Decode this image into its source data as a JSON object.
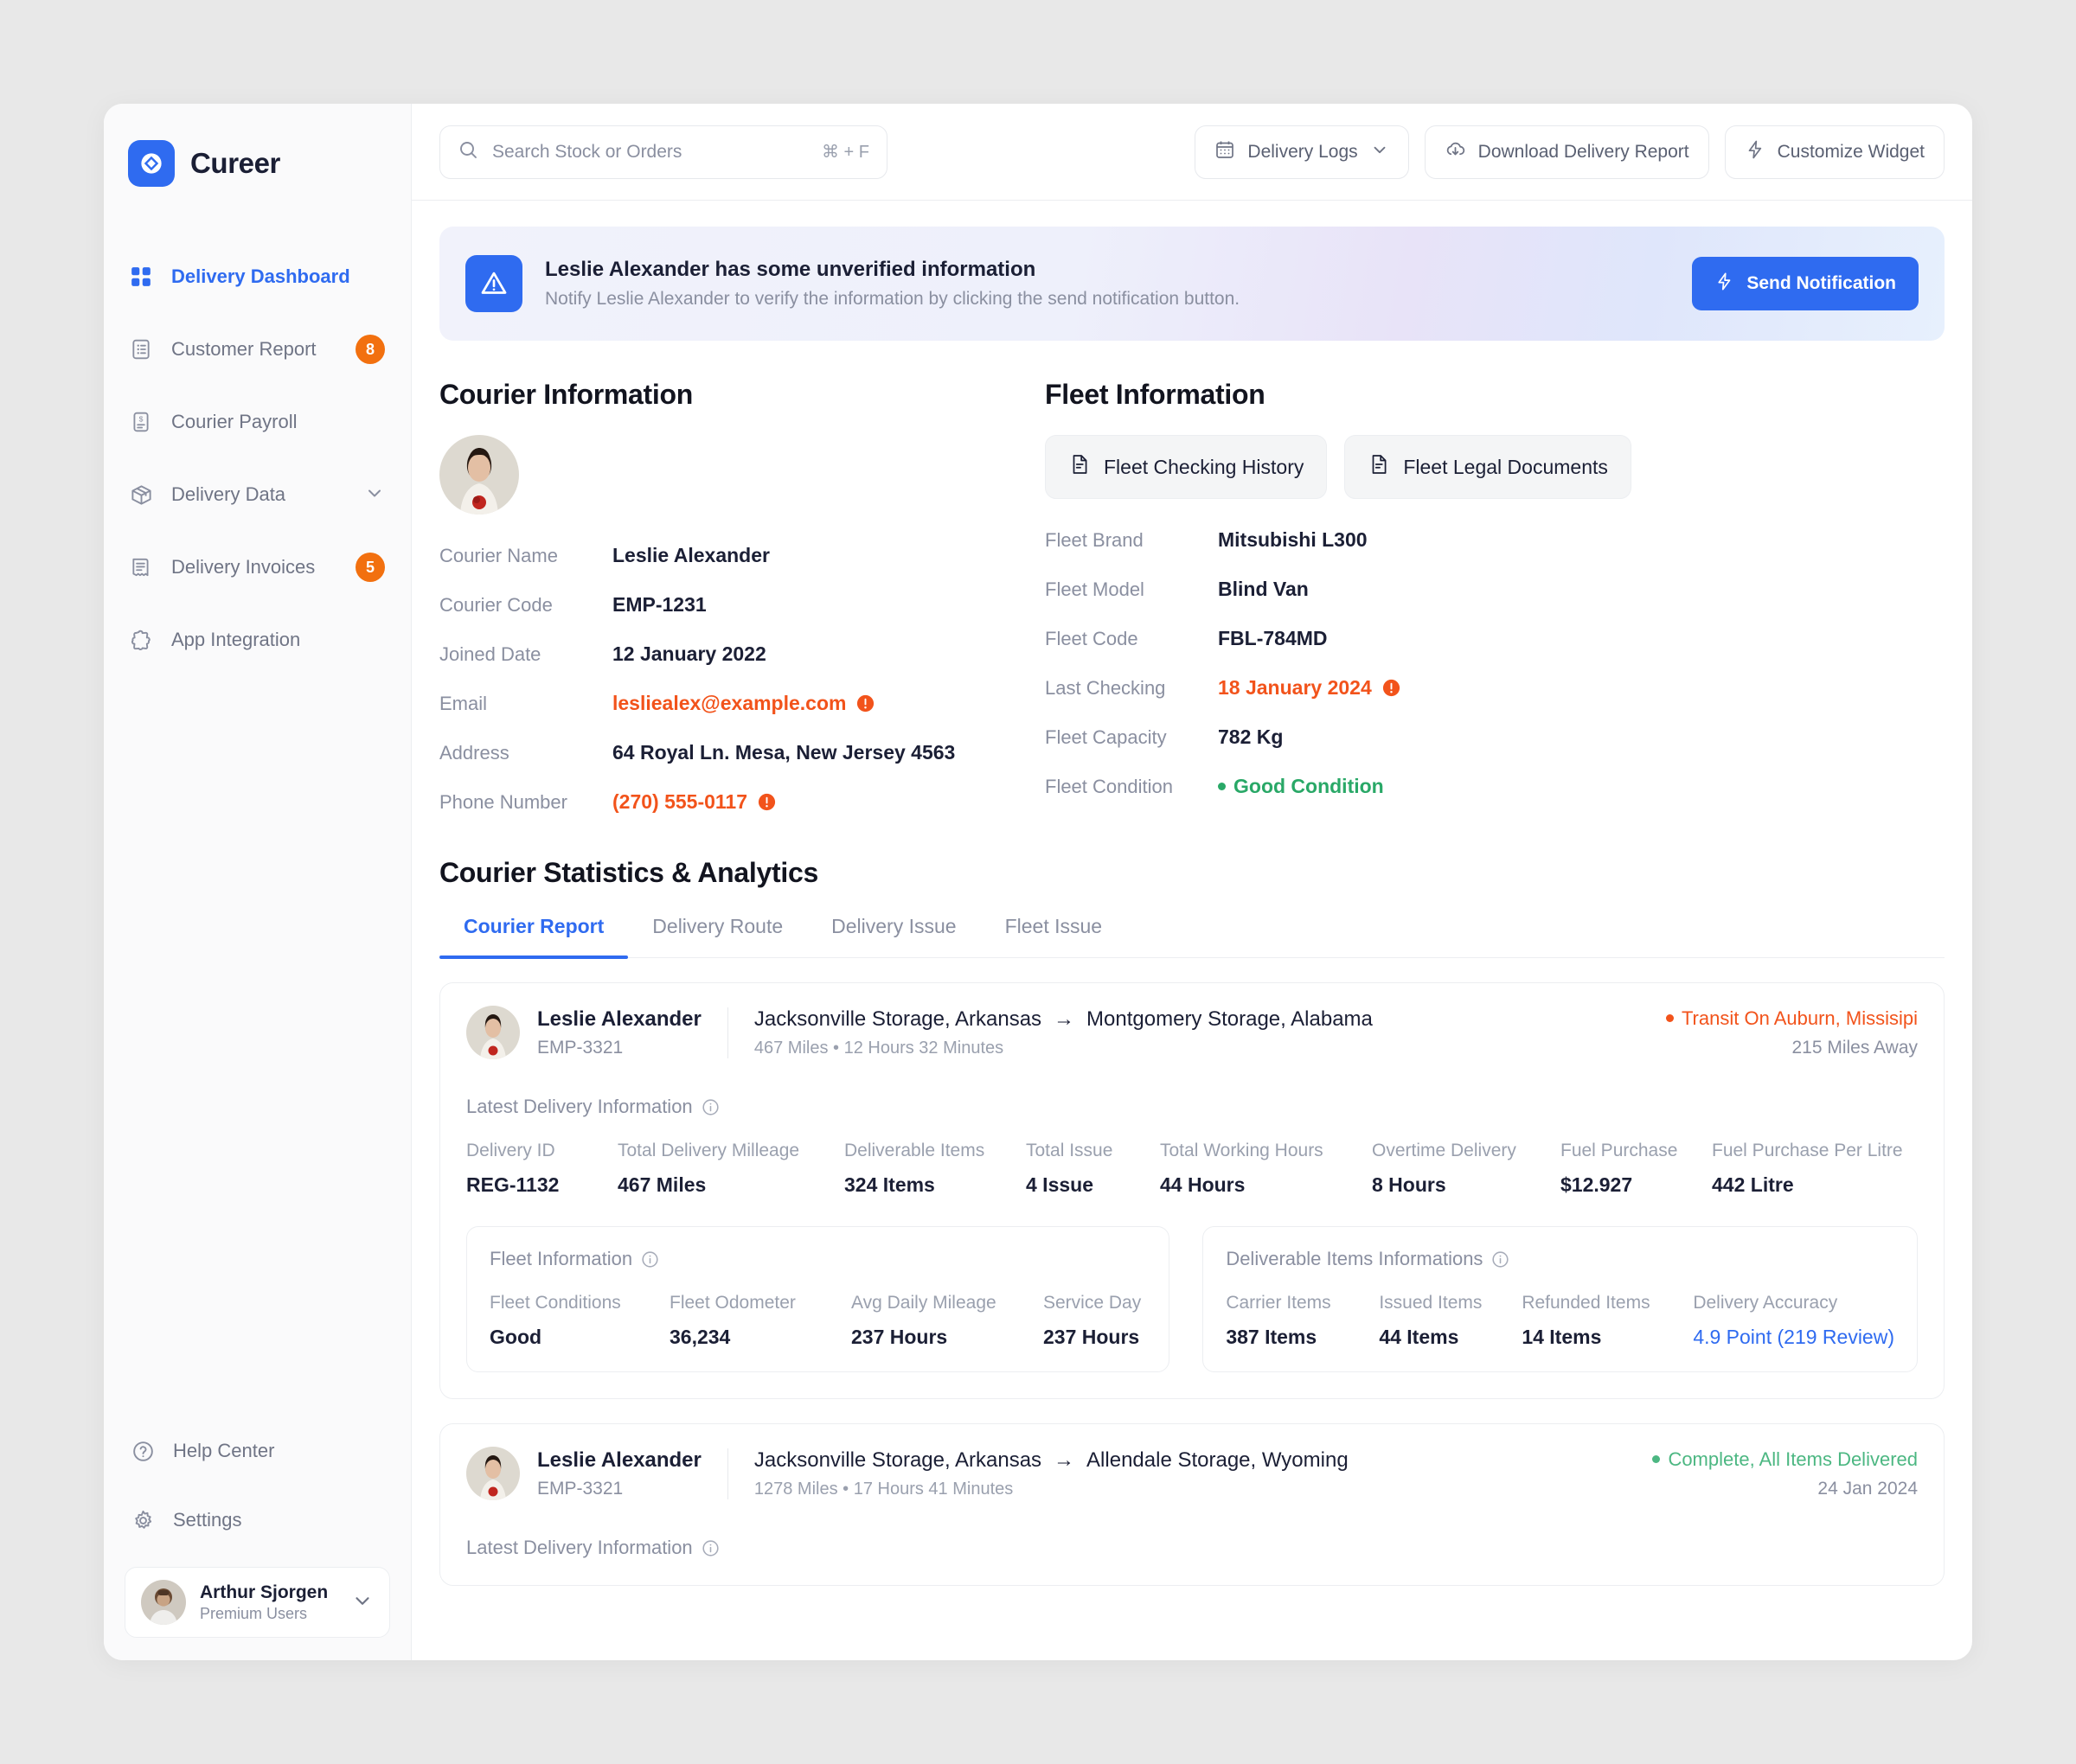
{
  "brand": {
    "name": "Cureer",
    "logo_icon": "diamond-logo-icon",
    "accent": "#2f6bf0"
  },
  "sidebar": {
    "items": [
      {
        "label": "Delivery Dashboard",
        "icon": "grid-icon",
        "active": true,
        "badge": ""
      },
      {
        "label": "Customer Report",
        "icon": "clipboard-list-icon",
        "active": false,
        "badge": "8"
      },
      {
        "label": "Courier Payroll",
        "icon": "payroll-document-icon",
        "active": false,
        "badge": ""
      },
      {
        "label": "Delivery Data",
        "icon": "box-icon",
        "active": false,
        "badge": "",
        "chevron": true
      },
      {
        "label": "Delivery Invoices",
        "icon": "invoice-icon",
        "active": false,
        "badge": "5"
      },
      {
        "label": "App Integration",
        "icon": "puzzle-icon",
        "active": false,
        "badge": ""
      }
    ],
    "help_center": "Help Center",
    "settings": "Settings",
    "profile": {
      "name": "Arthur Sjorgen",
      "role": "Premium Users"
    }
  },
  "topbar": {
    "search_placeholder": "Search Stock or Orders",
    "search_shortcut": "⌘ + F",
    "delivery_logs": "Delivery Logs",
    "download_report": "Download Delivery Report",
    "customize_widget": "Customize Widget"
  },
  "banner": {
    "title": "Leslie Alexander has some unverified information",
    "subtitle": "Notify Leslie Alexander to verify the information by clicking the send notification button.",
    "button": "Send Notification"
  },
  "courier": {
    "section_title": "Courier Information",
    "fields": [
      {
        "label": "Courier Name",
        "value": "Leslie Alexander",
        "alert": false
      },
      {
        "label": "Courier Code",
        "value": "EMP-1231",
        "alert": false
      },
      {
        "label": "Joined Date",
        "value": "12 January 2022",
        "alert": false
      },
      {
        "label": "Email",
        "value": "lesliealex@example.com",
        "alert": true
      },
      {
        "label": "Address",
        "value": "64 Royal Ln. Mesa, New Jersey 4563",
        "alert": false
      },
      {
        "label": "Phone Number",
        "value": "(270) 555-0117",
        "alert": true
      }
    ]
  },
  "fleet": {
    "section_title": "Fleet Information",
    "buttons": [
      {
        "label": "Fleet Checking History",
        "icon": "document-icon"
      },
      {
        "label": "Fleet Legal Documents",
        "icon": "document-icon"
      }
    ],
    "fields": [
      {
        "label": "Fleet Brand",
        "value": "Mitsubishi L300",
        "alert": false,
        "ok": false
      },
      {
        "label": "Fleet Model",
        "value": "Blind Van",
        "alert": false,
        "ok": false
      },
      {
        "label": "Fleet Code",
        "value": "FBL-784MD",
        "alert": false,
        "ok": false
      },
      {
        "label": "Last Checking",
        "value": "18 January 2024",
        "alert": true,
        "ok": false
      },
      {
        "label": "Fleet Capacity",
        "value": "782 Kg",
        "alert": false,
        "ok": false
      },
      {
        "label": "Fleet Condition",
        "value": "Good Condition",
        "alert": false,
        "ok": true
      }
    ]
  },
  "analytics": {
    "title": "Courier Statistics & Analytics",
    "tabs": [
      {
        "label": "Courier Report",
        "active": true
      },
      {
        "label": "Delivery Route",
        "active": false
      },
      {
        "label": "Delivery Issue",
        "active": false
      },
      {
        "label": "Fleet Issue",
        "active": false
      }
    ],
    "rows": [
      {
        "name": "Leslie Alexander",
        "code": "EMP-3321",
        "origin": "Jacksonville Storage, Arkansas",
        "arrow": "→",
        "destination": "Montgomery Storage, Alabama",
        "meta": "467 Miles • 12 Hours 32 Minutes",
        "status": "Transit On Auburn, Missisipi",
        "status_type": "transit",
        "status_sub": "215 Miles Away",
        "latest_title": "Latest Delivery Information",
        "stats": [
          {
            "k": "Delivery ID",
            "v": "REG-1132"
          },
          {
            "k": "Total Delivery Milleage",
            "v": "467 Miles"
          },
          {
            "k": "Deliverable Items",
            "v": "324 Items"
          },
          {
            "k": "Total Issue",
            "v": "4 Issue"
          },
          {
            "k": "Total Working Hours",
            "v": "44 Hours"
          },
          {
            "k": "Overtime Delivery",
            "v": "8 Hours"
          },
          {
            "k": "Fuel Purchase",
            "v": "$12.927"
          },
          {
            "k": "Fuel Purchase Per Litre",
            "v": "442 Litre"
          }
        ],
        "fleet_card": {
          "title": "Fleet Information",
          "stats": [
            {
              "k": "Fleet Conditions",
              "v": "Good"
            },
            {
              "k": "Fleet Odometer",
              "v": "36,234"
            },
            {
              "k": "Avg Daily Mileage",
              "v": "237 Hours"
            },
            {
              "k": "Service Day",
              "v": "237 Hours"
            }
          ]
        },
        "items_card": {
          "title": "Deliverable Items Informations",
          "stats": [
            {
              "k": "Carrier Items",
              "v": "387 Items"
            },
            {
              "k": "Issued Items",
              "v": "44 Items"
            },
            {
              "k": "Refunded Items",
              "v": "14 Items"
            }
          ],
          "accuracy_label": "Delivery Accuracy",
          "accuracy_point": "4.9 Point",
          "accuracy_reviews": "(219 Review)"
        }
      },
      {
        "name": "Leslie Alexander",
        "code": "EMP-3321",
        "origin": "Jacksonville Storage, Arkansas",
        "arrow": "→",
        "destination": "Allendale Storage, Wyoming",
        "meta": "1278 Miles • 17 Hours 41 Minutes",
        "status": "Complete, All Items Delivered",
        "status_type": "complete",
        "status_sub": "24 Jan 2024",
        "latest_title": "Latest Delivery Information"
      }
    ]
  },
  "colors": {
    "accent": "#2f6bf0",
    "alert": "#f2531b",
    "badge": "#f2700f",
    "success": "#29a867",
    "complete": "#4cb782"
  }
}
